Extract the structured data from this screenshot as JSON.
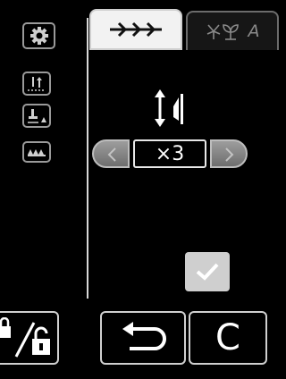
{
  "sidebar": {
    "settings_icon": "gear-icon",
    "needle_icon": "needle-position-icon",
    "presser_icon": "presser-foot-icon",
    "feed_icon": "feed-dog-icon"
  },
  "tabs": [
    {
      "id": "stitch",
      "icon": "utility-stitch-icon",
      "active": true
    },
    {
      "id": "decorative",
      "label": "A",
      "icon": "decorative-stitch-icon",
      "active": false
    }
  ],
  "main": {
    "mirror_icon": "mirror-vertical-icon",
    "stepper": {
      "value": "×3"
    },
    "confirm_icon": "checkmark-icon"
  },
  "bottom": {
    "lock_icon": "lock-unlock-icon",
    "undo_icon": "undo-icon",
    "clear_label": "C"
  }
}
